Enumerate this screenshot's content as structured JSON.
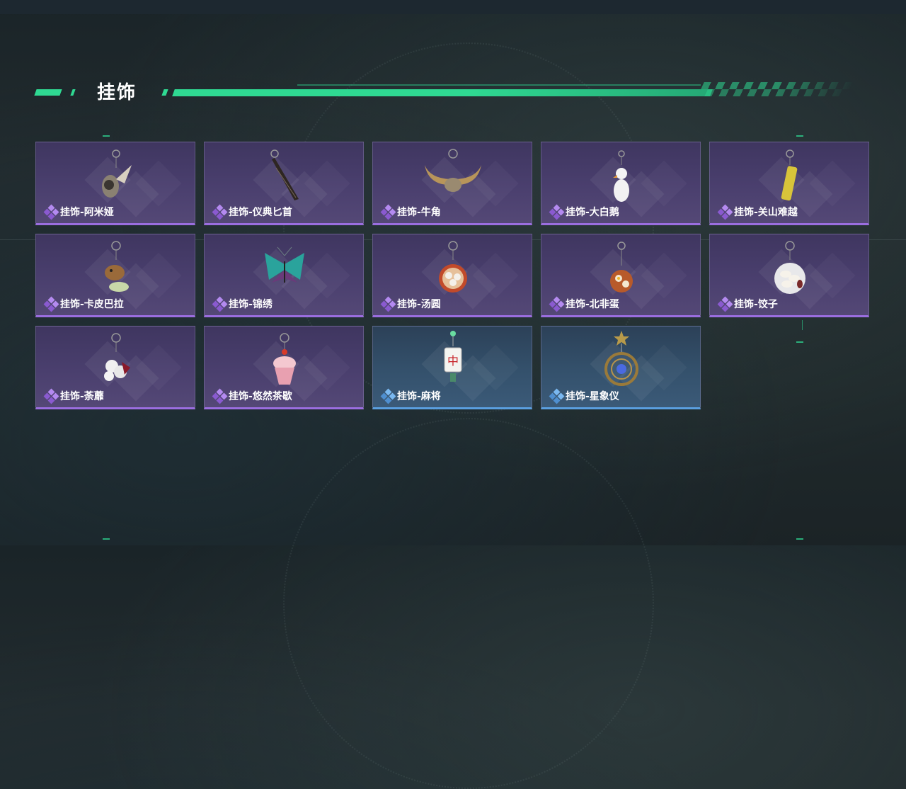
{
  "header": {
    "title": "挂饰"
  },
  "colors": {
    "accent": "#2fd992",
    "purple_rarity": "#9b6ee0",
    "blue_rarity": "#5a9fe0"
  },
  "items": [
    {
      "label": "挂饰-阿米娅",
      "rarity": "purple",
      "icon": "charm-amiya-icon"
    },
    {
      "label": "挂饰-仪典匕首",
      "rarity": "purple",
      "icon": "charm-dagger-icon"
    },
    {
      "label": "挂饰-牛角",
      "rarity": "purple",
      "icon": "charm-horns-icon"
    },
    {
      "label": "挂饰-大白鹅",
      "rarity": "purple",
      "icon": "charm-goose-icon"
    },
    {
      "label": "挂饰-关山难越",
      "rarity": "purple",
      "icon": "charm-tube-icon"
    },
    {
      "label": "挂饰-卡皮巴拉",
      "rarity": "purple",
      "icon": "charm-capybara-icon"
    },
    {
      "label": "挂饰-锦绣",
      "rarity": "purple",
      "icon": "charm-butterfly-icon"
    },
    {
      "label": "挂饰-汤圆",
      "rarity": "purple",
      "icon": "charm-tangyuan-icon"
    },
    {
      "label": "挂饰-北非蛋",
      "rarity": "purple",
      "icon": "charm-shakshuka-icon"
    },
    {
      "label": "挂饰-饺子",
      "rarity": "purple",
      "icon": "charm-dumplings-icon"
    },
    {
      "label": "挂饰-荼蘼",
      "rarity": "purple",
      "icon": "charm-flower-icon"
    },
    {
      "label": "挂饰-悠然茶歇",
      "rarity": "purple",
      "icon": "charm-cupcake-icon"
    },
    {
      "label": "挂饰-麻将",
      "rarity": "blue",
      "icon": "charm-mahjong-icon"
    },
    {
      "label": "挂饰-星象仪",
      "rarity": "blue",
      "icon": "charm-astrolabe-icon"
    }
  ]
}
